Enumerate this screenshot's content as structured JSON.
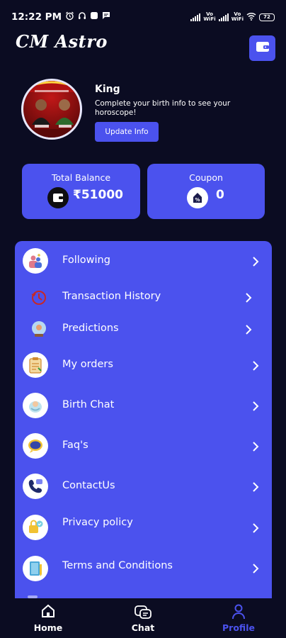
{
  "status_bar": {
    "time": "12:22 PM",
    "network_label_1": "Vo\nWiFi",
    "network_label_2": "Vo\nWiFi",
    "battery": "72"
  },
  "header": {
    "app_title": "CM Astro",
    "wallet_icon": "wallet-icon"
  },
  "profile": {
    "name": "King",
    "message": "Complete your birth info to see your horoscope!",
    "update_button": "Update Info"
  },
  "cards": {
    "balance": {
      "label": "Total Balance",
      "value": "₹51000",
      "icon": "wallet-icon"
    },
    "coupon": {
      "label": "Coupon",
      "value": "0",
      "icon": "coupon-icon"
    }
  },
  "menu": {
    "items": [
      {
        "label": "Following",
        "icon": "following-icon"
      },
      {
        "label": "Transaction History",
        "icon": "transaction-history-icon"
      },
      {
        "label": "Predictions",
        "icon": "predictions-icon"
      },
      {
        "label": "My orders",
        "icon": "orders-icon"
      },
      {
        "label": "Birth Chat",
        "icon": "birth-chat-icon"
      },
      {
        "label": "Faq's",
        "icon": "faq-icon"
      },
      {
        "label": "ContactUs",
        "icon": "contact-icon"
      },
      {
        "label": "Privacy policy",
        "icon": "privacy-icon"
      },
      {
        "label": "Terms and Conditions",
        "icon": "terms-icon"
      }
    ]
  },
  "bottom_nav": {
    "items": [
      {
        "label": "Home",
        "icon": "home-icon",
        "active": false
      },
      {
        "label": "Chat",
        "icon": "chat-icon",
        "active": false
      },
      {
        "label": "Profile",
        "icon": "profile-icon",
        "active": true
      }
    ]
  },
  "colors": {
    "background": "#0b0c22",
    "accent": "#4b52ee",
    "active_nav": "#4b52ee",
    "text": "#ffffff"
  }
}
